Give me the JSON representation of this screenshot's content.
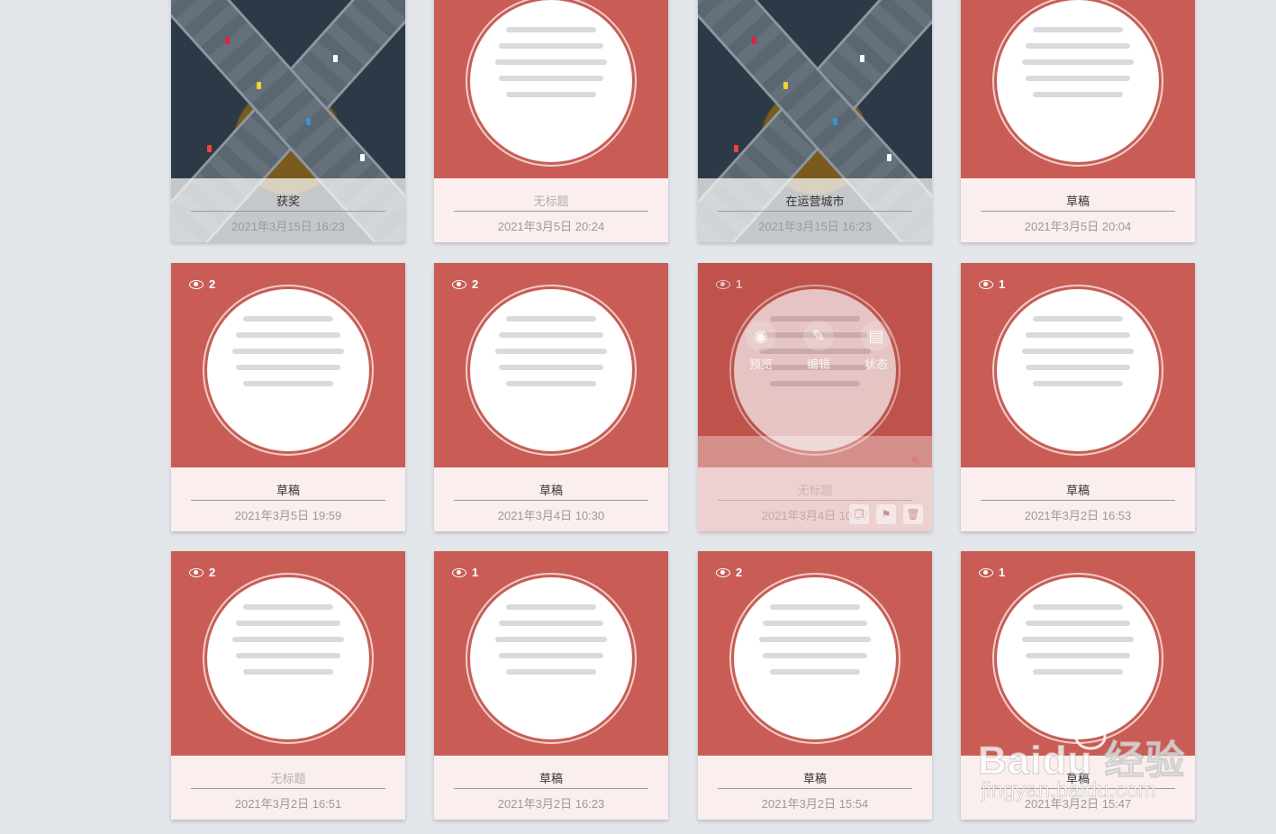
{
  "cards": [
    {
      "type": "photo",
      "title": "获奖",
      "date": "2021年3月15日 16:23"
    },
    {
      "type": "doc",
      "title": "无标题",
      "date": "2021年3月5日 20:24",
      "muted": true
    },
    {
      "type": "photo",
      "title": "在运营城市",
      "date": "2021年3月15日 16:23"
    },
    {
      "type": "doc",
      "title": "草稿",
      "date": "2021年3月5日 20:04"
    },
    {
      "type": "doc",
      "views": "2",
      "title": "草稿",
      "date": "2021年3月5日 19:59"
    },
    {
      "type": "doc",
      "views": "2",
      "title": "草稿",
      "date": "2021年3月4日 10:30"
    },
    {
      "type": "doc",
      "views": "1",
      "title": "无标题",
      "date": "2021年3月4日 10:27",
      "muted": true,
      "hover": true
    },
    {
      "type": "doc",
      "views": "1",
      "title": "草稿",
      "date": "2021年3月2日 16:53"
    },
    {
      "type": "doc",
      "views": "2",
      "title": "无标题",
      "date": "2021年3月2日 16:51",
      "muted": true
    },
    {
      "type": "doc",
      "views": "1",
      "title": "草稿",
      "date": "2021年3月2日 16:23"
    },
    {
      "type": "doc",
      "views": "2",
      "title": "草稿",
      "date": "2021年3月2日 15:54"
    },
    {
      "type": "doc",
      "views": "1",
      "title": "草稿",
      "date": "2021年3月2日 15:47"
    }
  ],
  "hover_actions": {
    "preview": "预览",
    "edit": "编辑",
    "status": "状态"
  },
  "watermark": {
    "brand": "Baidu 经验",
    "url": "jingyan.baidu.com"
  },
  "colors": {
    "thumb_red": "#c95d55",
    "footer_bg": "#fbeeee",
    "page_bg": "#e3e6ea"
  },
  "icons": {
    "views": "eye-icon",
    "preview": "eye-icon",
    "edit": "pencil-icon",
    "status": "easel-icon",
    "copy": "copy-icon",
    "bookmark": "bookmark-icon",
    "delete": "trash-icon"
  }
}
